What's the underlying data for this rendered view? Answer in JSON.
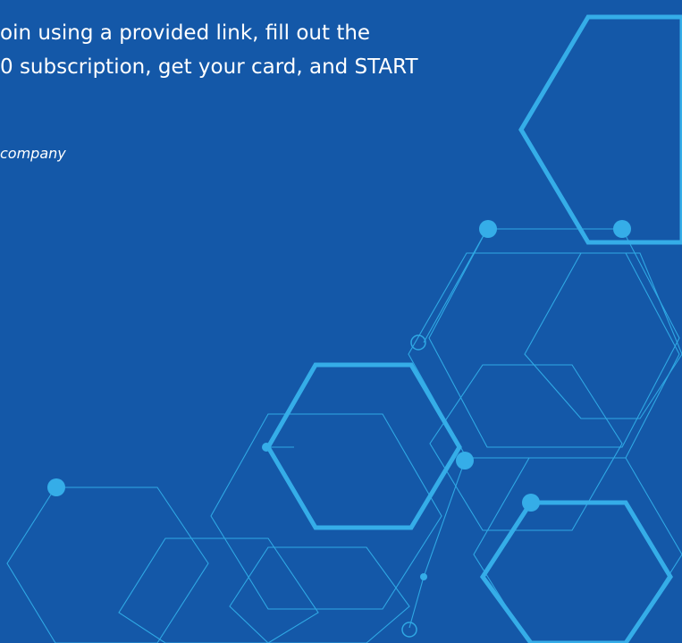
{
  "page": {
    "background_color": "#1458a8",
    "accent_color": "#35ade8",
    "text_color": "#ffffff"
  },
  "text": {
    "line_1": "oin using a provided link, fill out the",
    "line_2": "0 subscription, get your card, and START",
    "attribution": "company"
  },
  "decoration": {
    "pattern": "hexagon-network"
  }
}
